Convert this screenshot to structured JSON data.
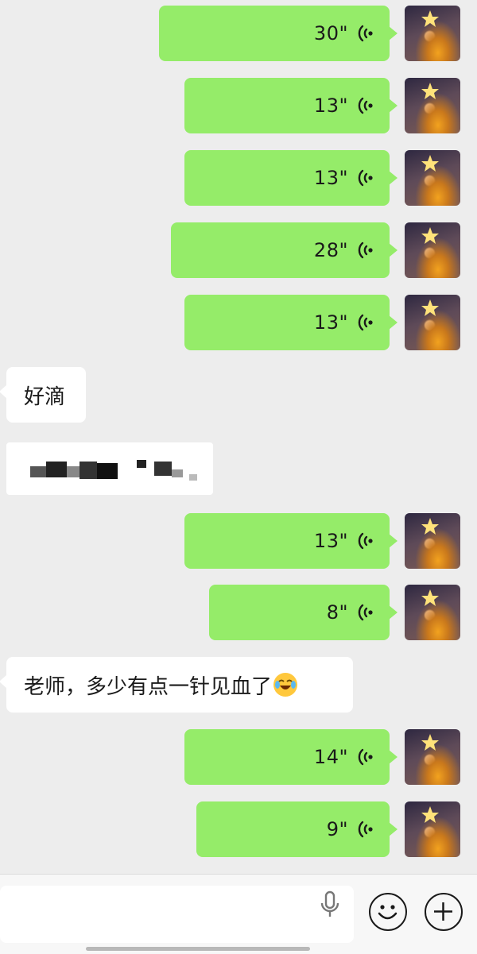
{
  "messages": [
    {
      "type": "voice",
      "direction": "out",
      "duration": "30\""
    },
    {
      "type": "voice",
      "direction": "out",
      "duration": "13\""
    },
    {
      "type": "voice",
      "direction": "out",
      "duration": "13\""
    },
    {
      "type": "voice",
      "direction": "out",
      "duration": "28\""
    },
    {
      "type": "voice",
      "direction": "out",
      "duration": "13\""
    },
    {
      "type": "text",
      "direction": "in",
      "text": "好滴"
    },
    {
      "type": "text",
      "direction": "in",
      "text": "",
      "note_redacted": true
    },
    {
      "type": "voice",
      "direction": "out",
      "duration": "13\""
    },
    {
      "type": "voice",
      "direction": "out",
      "duration": "8\""
    },
    {
      "type": "text",
      "direction": "in",
      "text": "老师，多少有点一针见血了",
      "emoji": "rolling-laughing-emoji"
    },
    {
      "type": "voice",
      "direction": "out",
      "duration": "14\""
    },
    {
      "type": "voice",
      "direction": "out",
      "duration": "9\""
    }
  ],
  "colors": {
    "outgoing_bubble": "#95ec69",
    "incoming_bubble": "#ffffff",
    "background": "#ededed"
  },
  "input_bar": {
    "icons": [
      "microphone-icon",
      "emoji-icon",
      "plus-icon"
    ]
  }
}
